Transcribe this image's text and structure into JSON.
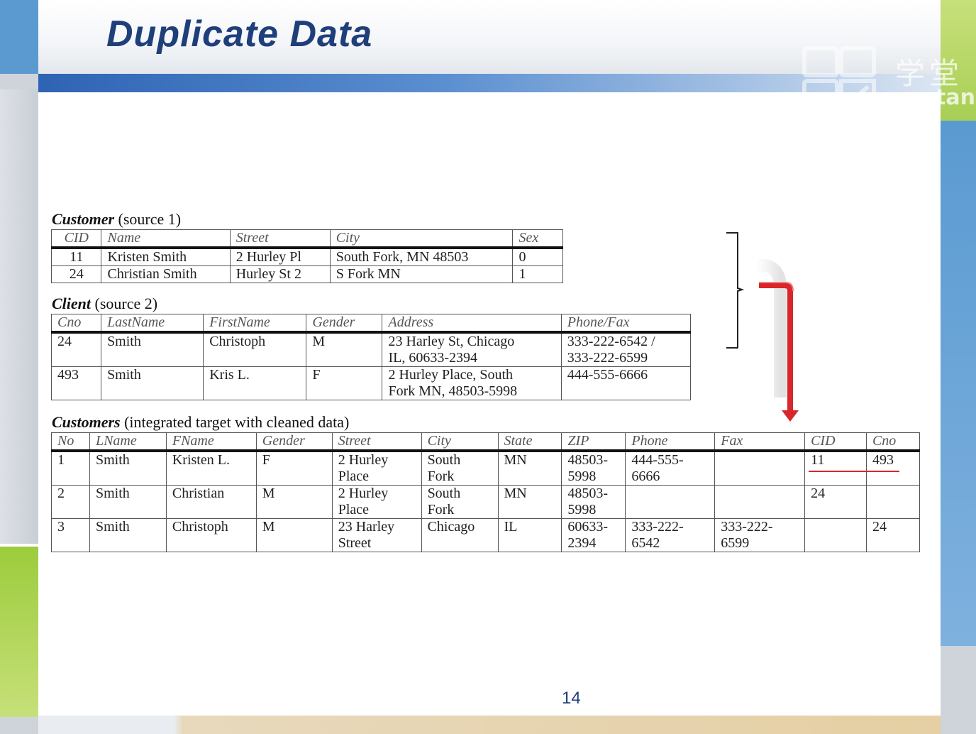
{
  "slide": {
    "title": "Duplicate Data",
    "page_number": "14"
  },
  "watermark": {
    "cn": "学堂",
    "en": "xuetan"
  },
  "customer_table": {
    "caption_name": "Customer",
    "caption_suffix": " (source 1)",
    "headers": [
      "CID",
      "Name",
      "Street",
      "City",
      "Sex"
    ],
    "rows": [
      [
        "11",
        "Kristen Smith",
        "2 Hurley Pl",
        "South Fork, MN 48503",
        "0"
      ],
      [
        "24",
        "Christian Smith",
        "Hurley St 2",
        "S Fork MN",
        "1"
      ]
    ]
  },
  "client_table": {
    "caption_name": "Client",
    "caption_suffix": " (source 2)",
    "headers": [
      "Cno",
      "LastName",
      "FirstName",
      "Gender",
      "Address",
      "Phone/Fax"
    ],
    "rows": [
      [
        "24",
        "Smith",
        "Christoph",
        "M",
        "23 Harley St, Chicago\nIL, 60633-2394",
        "333-222-6542 /\n333-222-6599"
      ],
      [
        "493",
        "Smith",
        "Kris L.",
        "F",
        "2 Hurley Place, South\nFork MN, 48503-5998",
        "444-555-6666"
      ]
    ]
  },
  "customers_table": {
    "caption_name": "Customers",
    "caption_suffix": " (integrated target with cleaned data)",
    "headers": [
      "No",
      "LName",
      "FName",
      "Gender",
      "Street",
      "City",
      "State",
      "ZIP",
      "Phone",
      "Fax",
      "CID",
      "Cno"
    ],
    "rows": [
      [
        "1",
        "Smith",
        "Kristen L.",
        "F",
        "2 Hurley\nPlace",
        "South\nFork",
        "MN",
        "48503-\n5998",
        "444-555-\n6666",
        "",
        "11",
        "493"
      ],
      [
        "2",
        "Smith",
        "Christian",
        "M",
        "2 Hurley\nPlace",
        "South\nFork",
        "MN",
        "48503-\n5998",
        "",
        "",
        "24",
        ""
      ],
      [
        "3",
        "Smith",
        "Christoph",
        "M",
        "23 Harley\nStreet",
        "Chicago",
        "IL",
        "60633-\n2394",
        "333-222-\n6542",
        "333-222-\n6599",
        "",
        "24"
      ]
    ]
  },
  "colors": {
    "title": "#1f3f7a",
    "arrow": "#d8262a",
    "rule_blue": "#2e63b4",
    "accent_green": "#9ccc3c"
  }
}
